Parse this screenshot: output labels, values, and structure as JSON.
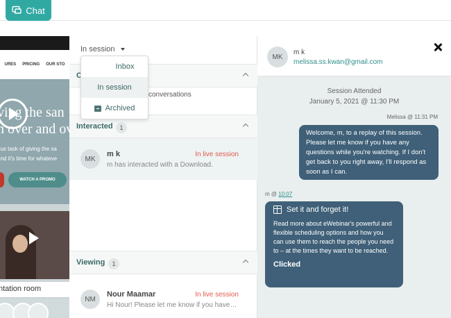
{
  "header": {
    "chat_tab_label": "Chat",
    "accent_color": "#31a9a3"
  },
  "video": {
    "nav_items": [
      "URES",
      "PRICING",
      "OUR STO"
    ],
    "hero_line1": "ving the san",
    "hero_line2": "n over and ov",
    "hero_sub1": "ous task of giving the sa",
    "hero_sub2": "and it's time for whateve",
    "promo_label": "WATCH A PROMO",
    "caption": "ntation room"
  },
  "middle": {
    "session_filter": "In session",
    "dropdown": {
      "items": [
        "Inbox",
        "In session",
        "Archived"
      ],
      "selected": "In session"
    },
    "sections": {
      "first_initial": "C",
      "conversations_text": "conversations",
      "interacted": {
        "title": "Interacted",
        "count": "1"
      },
      "viewing": {
        "title": "Viewing",
        "count": "1"
      }
    },
    "conversations": [
      {
        "initials": "MK",
        "name": "m k",
        "status": "In live session",
        "preview": "m has interacted with a Download."
      },
      {
        "initials": "NM",
        "name": "Nour Maamar",
        "status": "In live session",
        "preview": "Hi Nour! Please let me know if you have any questions"
      }
    ]
  },
  "right": {
    "contact": {
      "initials": "MK",
      "name": "m k",
      "email": "melissa.ss.kwan@gmail.com"
    },
    "session": {
      "label": "Session Attended",
      "date": "January 5, 2021 @ 11:30 PM"
    },
    "message_out": {
      "meta": "Melissa @ 11:31 PM",
      "text": "Welcome, m, to a replay of this session. Please let me know if you have any questions while you're watching. If I don't get back to you right away, I'll respond as soon as I can."
    },
    "message_in": {
      "meta_prefix": "m @ ",
      "meta_time": "10:07",
      "title": "Set it and forget it!",
      "body": "Read more about eWebinar's powerful and flexible scheduling options and how you can use them to reach the people you need to – at the times they want to be reached.",
      "status": "Clicked"
    }
  }
}
